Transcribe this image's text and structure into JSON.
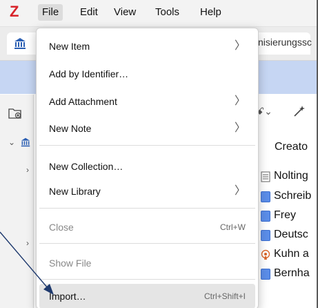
{
  "menubar": {
    "app_logo": "Z",
    "menus": [
      "File",
      "Edit",
      "View",
      "Tools",
      "Help"
    ]
  },
  "tab": {
    "title_fragment": "nisierungssc"
  },
  "item_list": {
    "column_header": "Creato",
    "rows": [
      {
        "icon": "note-icon",
        "text": "Nolting"
      },
      {
        "icon": "book-icon",
        "text": "Schreib"
      },
      {
        "icon": "book-icon",
        "text": "Frey"
      },
      {
        "icon": "book-icon",
        "text": "Deutsc"
      },
      {
        "icon": "podcast-icon",
        "text": "Kuhn a"
      },
      {
        "icon": "book-icon",
        "text": "Bernha"
      }
    ]
  },
  "file_menu": {
    "items": [
      {
        "label": "New Item",
        "submenu": true,
        "shortcut": "",
        "enabled": true
      },
      {
        "label": "Add by Identifier…",
        "submenu": false,
        "shortcut": "",
        "enabled": true
      },
      {
        "label": "Add Attachment",
        "submenu": true,
        "shortcut": "",
        "enabled": true
      },
      {
        "label": "New Note",
        "submenu": true,
        "shortcut": "",
        "enabled": true
      },
      {
        "label": "New Collection…",
        "submenu": false,
        "shortcut": "",
        "enabled": true
      },
      {
        "label": "New Library",
        "submenu": true,
        "shortcut": "",
        "enabled": true
      },
      {
        "label": "Close",
        "submenu": false,
        "shortcut": "Ctrl+W",
        "enabled": false
      },
      {
        "label": "Show File",
        "submenu": false,
        "shortcut": "",
        "enabled": false
      },
      {
        "label": "Import…",
        "submenu": false,
        "shortcut": "Ctrl+Shift+I",
        "enabled": true,
        "highlighted": true
      }
    ],
    "submenu_arrow": "〉"
  },
  "colors": {
    "accent_band": "#c6d6f3",
    "logo_red": "#d8232a",
    "annotation_arrow": "#1f3a6e"
  }
}
